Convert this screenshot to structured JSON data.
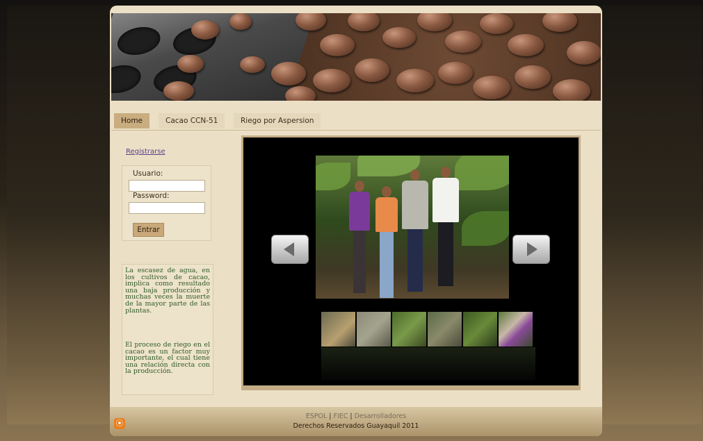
{
  "nav": {
    "tabs": [
      "Home",
      "Cacao CCN-51",
      "Riego por Aspersion"
    ],
    "active": 0
  },
  "sidebar": {
    "register_link": "Registrarse",
    "login": {
      "user_label": "Usuario:",
      "password_label": "Password:",
      "user_value": "",
      "password_value": "",
      "submit_label": "Entrar"
    },
    "info": {
      "p1": "La escasez de agua, en los cultivos de cacao, implica como resultado una baja producción y muchas veces la muerte de la mayor parte de las plantas.",
      "p2": "El proceso de riego en el cacao es un factor muy importante, el cual tiene una relación directa con la producción."
    }
  },
  "gallery": {
    "thumb_count": 6,
    "prev_icon": "arrow-left-icon",
    "next_icon": "arrow-right-icon"
  },
  "footer": {
    "links": [
      "ESPOL",
      "FIEC",
      "Desarrolladores"
    ],
    "copyright": "Derechos Reservados Guayaquil 2011",
    "rss_icon": "rss-icon"
  },
  "colors": {
    "page_bg": "#ebe0c6",
    "active_tab": "#c9ad80",
    "text_green": "#2f5a26",
    "link_purple": "#5b3f8a"
  }
}
